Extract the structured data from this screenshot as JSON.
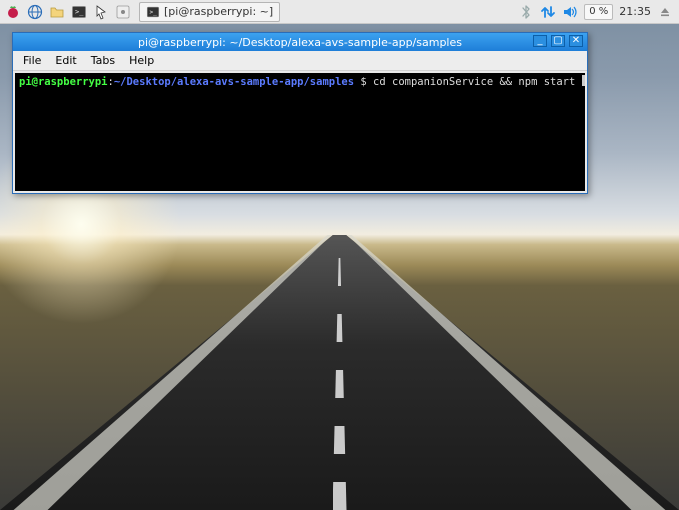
{
  "taskbar": {
    "launchers": [
      {
        "name": "raspberry-menu-icon",
        "title": "Menu"
      },
      {
        "name": "globe-icon",
        "title": "Web Browser"
      },
      {
        "name": "file-manager-icon",
        "title": "File Manager"
      },
      {
        "name": "terminal-icon",
        "title": "Terminal"
      },
      {
        "name": "mouse-pointer-icon",
        "title": "Accessory"
      },
      {
        "name": "settings-icon",
        "title": "Settings"
      }
    ],
    "active_task": {
      "icon": "terminal-icon",
      "label": "[pi@raspberrypi: ~]"
    },
    "tray": {
      "bluetooth_icon": "bluetooth-icon",
      "network_icon": "network-updown-icon",
      "volume_icon": "volume-icon",
      "cpu": "0 %",
      "clock": "21:35",
      "eject_icon": "eject-icon"
    }
  },
  "terminal_window": {
    "title": "pi@raspberrypi: ~/Desktop/alexa-avs-sample-app/samples",
    "menu": {
      "file": "File",
      "edit": "Edit",
      "tabs": "Tabs",
      "help": "Help"
    },
    "controls": {
      "min": "_",
      "max": "▢",
      "close": "✕"
    },
    "prompt": {
      "user_host": "pi@raspberrypi",
      "colon": ":",
      "path": "~/Desktop/alexa-avs-sample-app/samples",
      "sigil": " $ ",
      "command": "cd companionService && npm start"
    }
  },
  "colors": {
    "titlebar_start": "#3ca2f0",
    "titlebar_end": "#1e7ed8",
    "prompt_user": "#44ff44",
    "prompt_path": "#5b7bff"
  }
}
